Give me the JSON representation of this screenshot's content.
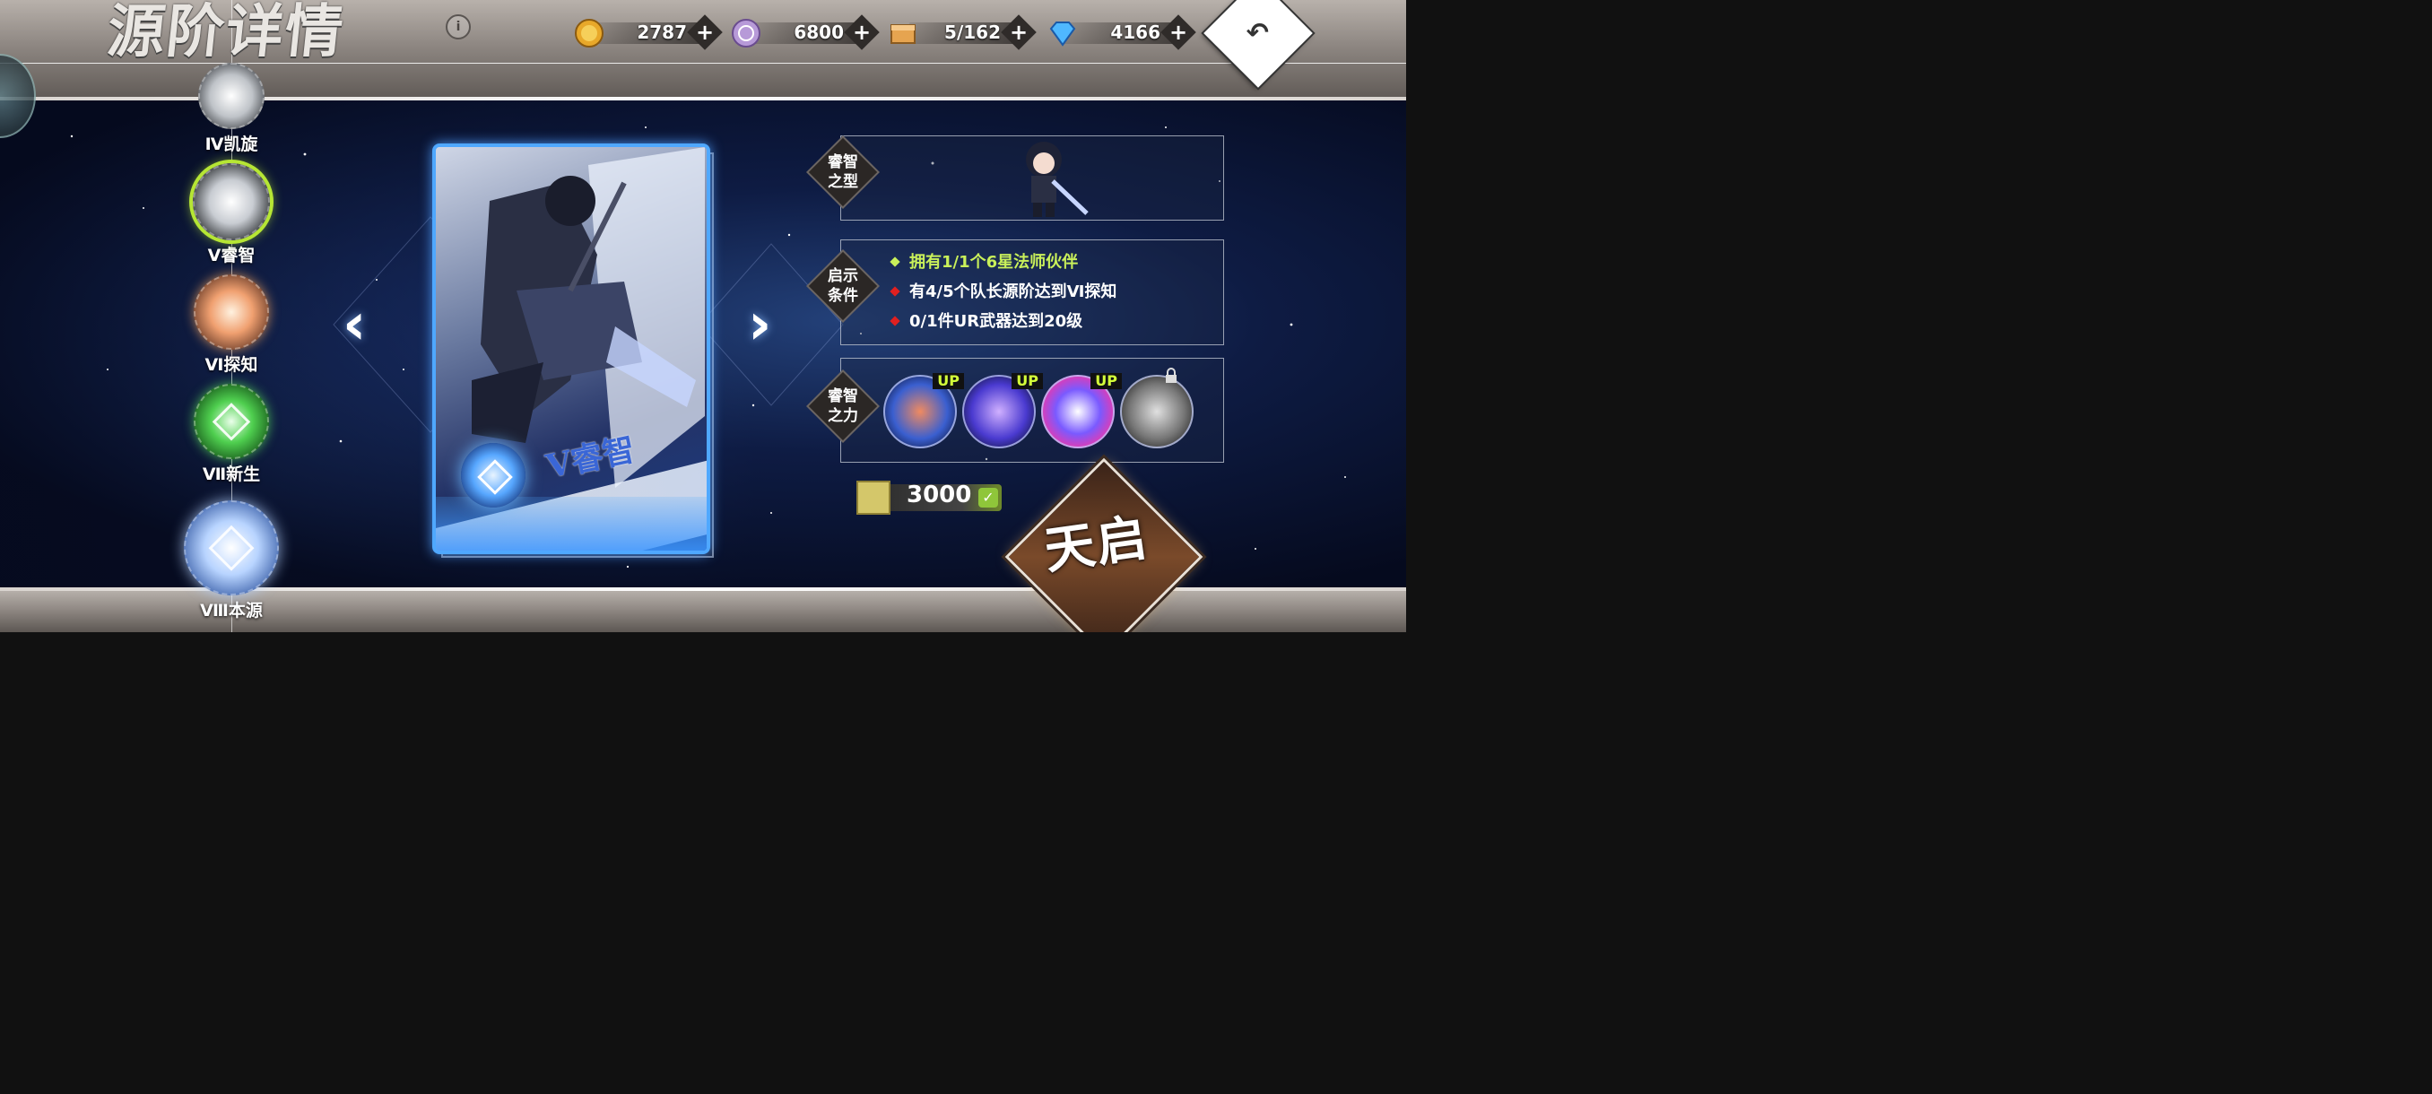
{
  "header": {
    "title": "源阶详情",
    "info_icon": "i"
  },
  "currencies": [
    {
      "icon": "gold-coin-icon",
      "value": "2787"
    },
    {
      "icon": "source-crystal-icon",
      "value": "6800"
    },
    {
      "icon": "supply-box-icon",
      "value": "5/162"
    },
    {
      "icon": "diamond-icon",
      "value": "4166"
    }
  ],
  "plus_symbol": "+",
  "back_symbol": "↶",
  "stages": [
    {
      "label": "Ⅳ凯旋",
      "color": "#d8d8d8"
    },
    {
      "label": "Ⅴ睿智",
      "color": "#e0e6ee"
    },
    {
      "label": "Ⅵ探知",
      "color": "#f0a070"
    },
    {
      "label": "Ⅶ新生",
      "color": "#4fcf4f"
    },
    {
      "label": "Ⅷ本源",
      "color": "#b8d4ff"
    }
  ],
  "card": {
    "title": "Ⅴ睿智"
  },
  "panels": {
    "type_tag": "睿智\n之型",
    "condition_tag": "启示\n条件",
    "power_tag": "睿智\n之力"
  },
  "conditions": [
    {
      "text": "拥有1/1个6星法师伙伴",
      "met": true
    },
    {
      "text": "有4/5个队长源阶达到Ⅵ探知",
      "met": false
    },
    {
      "text": "0/1件UR武器达到20级",
      "met": false
    }
  ],
  "skills": [
    {
      "badge": "UP",
      "color": "#3a5fd0"
    },
    {
      "badge": "UP",
      "color": "#4a3ad0"
    },
    {
      "badge": "UP",
      "color": "#7a5aff"
    },
    {
      "badge": "",
      "color": "#777777",
      "locked": true
    }
  ],
  "cost": {
    "value": "3000",
    "check": "✓"
  },
  "action_button": "天启",
  "arrows": {
    "left": "‹",
    "right": "›"
  }
}
